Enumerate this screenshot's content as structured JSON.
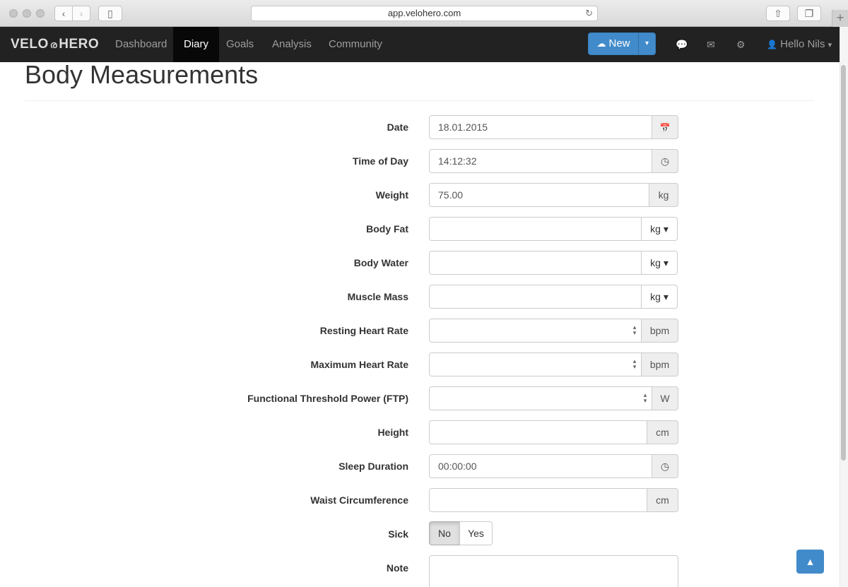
{
  "browser": {
    "url": "app.velohero.com",
    "back_glyph": "‹",
    "forward_glyph": "›",
    "sidebar_glyph": "▯",
    "share_glyph": "⇧",
    "tabs_glyph": "❐",
    "reload_glyph": "↻",
    "new_tab_glyph": "+"
  },
  "navbar": {
    "brand_left": "VELO",
    "brand_icon": "ര",
    "brand_right": "HERO",
    "items": [
      {
        "label": "Dashboard"
      },
      {
        "label": "Diary"
      },
      {
        "label": "Goals"
      },
      {
        "label": "Analysis"
      },
      {
        "label": "Community"
      }
    ],
    "active_item": "Diary",
    "new_button": {
      "label": "New",
      "icon": "☁",
      "caret": "▾"
    },
    "icons": {
      "chat": "💬",
      "mail": "✉",
      "settings": "⚙"
    },
    "user": {
      "icon": "👤",
      "label": "Hello Nils",
      "caret": "▾"
    }
  },
  "page": {
    "title": "Body Measurements"
  },
  "form": {
    "date": {
      "label": "Date",
      "value": "18.01.2015",
      "addon_icon": "📅"
    },
    "time_of_day": {
      "label": "Time of Day",
      "value": "14:12:32",
      "addon_icon": "◷"
    },
    "weight": {
      "label": "Weight",
      "value": "75.00",
      "unit": "kg"
    },
    "body_fat": {
      "label": "Body Fat",
      "value": "",
      "unit": "kg ▾"
    },
    "body_water": {
      "label": "Body Water",
      "value": "",
      "unit": "kg ▾"
    },
    "muscle_mass": {
      "label": "Muscle Mass",
      "value": "",
      "unit": "kg ▾"
    },
    "resting_hr": {
      "label": "Resting Heart Rate",
      "value": "",
      "unit": "bpm"
    },
    "max_hr": {
      "label": "Maximum Heart Rate",
      "value": "",
      "unit": "bpm"
    },
    "ftp": {
      "label": "Functional Threshold Power (FTP)",
      "value": "",
      "unit": "W"
    },
    "height": {
      "label": "Height",
      "value": "",
      "unit": "cm"
    },
    "sleep_duration": {
      "label": "Sleep Duration",
      "value": "00:00:00",
      "addon_icon": "◷"
    },
    "waist": {
      "label": "Waist Circumference",
      "value": "",
      "unit": "cm"
    },
    "sick": {
      "label": "Sick",
      "no": "No",
      "yes": "Yes",
      "selected": "No"
    },
    "note": {
      "label": "Note",
      "value": ""
    }
  },
  "spinner": {
    "up": "▴",
    "down": "▾"
  },
  "back_to_top_icon": "▲"
}
